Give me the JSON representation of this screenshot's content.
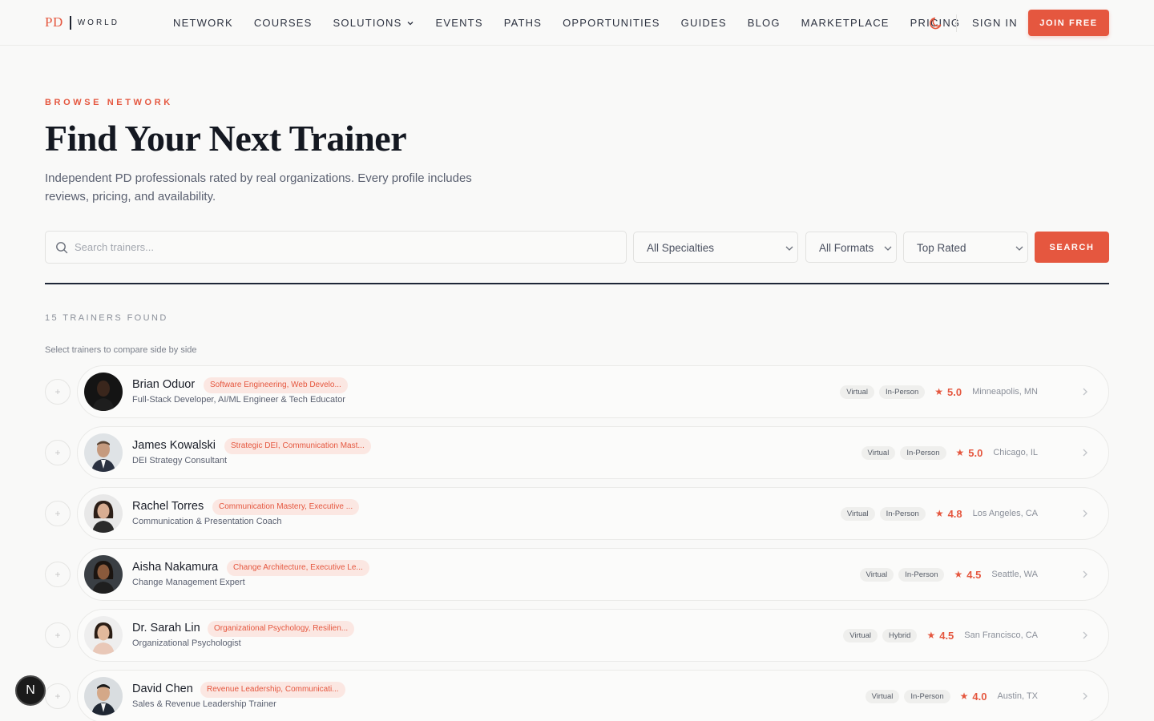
{
  "brand": {
    "mark": "PD",
    "word": "WORLD"
  },
  "nav": {
    "items": [
      "NETWORK",
      "COURSES",
      "SOLUTIONS",
      "EVENTS",
      "PATHS",
      "OPPORTUNITIES",
      "GUIDES",
      "BLOG",
      "MARKETPLACE",
      "PRICING"
    ],
    "theme_icon": "moon-icon",
    "signin": "SIGN IN",
    "join": "JOIN FREE"
  },
  "hero": {
    "eyebrow": "BROWSE NETWORK",
    "title": "Find Your Next Trainer",
    "subtitle": "Independent PD professionals rated by real organizations. Every profile includes reviews, pricing, and availability."
  },
  "filters": {
    "search_placeholder": "Search trainers...",
    "specialty": "All Specialties",
    "format": "All Formats",
    "sort": "Top Rated",
    "search_button": "SEARCH"
  },
  "results": {
    "count_label": "15 TRAINERS FOUND",
    "compare_hint": "Select trainers to compare side by side",
    "trainers": [
      {
        "name": "Brian Oduor",
        "tag": "Software Engineering, Web Develo...",
        "role": "Full-Stack Developer, AI/ML Engineer & Tech Educator",
        "formats": [
          "Virtual",
          "In-Person"
        ],
        "rating": "5.0",
        "location": "Minneapolis, MN"
      },
      {
        "name": "James Kowalski",
        "tag": "Strategic DEI, Communication Mast...",
        "role": "DEI Strategy Consultant",
        "formats": [
          "Virtual",
          "In-Person"
        ],
        "rating": "5.0",
        "location": "Chicago, IL"
      },
      {
        "name": "Rachel Torres",
        "tag": "Communication Mastery, Executive ...",
        "role": "Communication & Presentation Coach",
        "formats": [
          "Virtual",
          "In-Person"
        ],
        "rating": "4.8",
        "location": "Los Angeles, CA"
      },
      {
        "name": "Aisha Nakamura",
        "tag": "Change Architecture, Executive Le...",
        "role": "Change Management Expert",
        "formats": [
          "Virtual",
          "In-Person"
        ],
        "rating": "4.5",
        "location": "Seattle, WA"
      },
      {
        "name": "Dr. Sarah Lin",
        "tag": "Organizational Psychology, Resilien...",
        "role": "Organizational Psychologist",
        "formats": [
          "Virtual",
          "Hybrid"
        ],
        "rating": "4.5",
        "location": "San Francisco, CA"
      },
      {
        "name": "David Chen",
        "tag": "Revenue Leadership, Communicati...",
        "role": "Sales & Revenue Leadership Trainer",
        "formats": [
          "Virtual",
          "In-Person"
        ],
        "rating": "4.0",
        "location": "Austin, TX"
      }
    ]
  },
  "floating_badge": "N",
  "colors": {
    "accent": "#e5573f",
    "ink": "#141821",
    "background": "#f9f9f8"
  }
}
